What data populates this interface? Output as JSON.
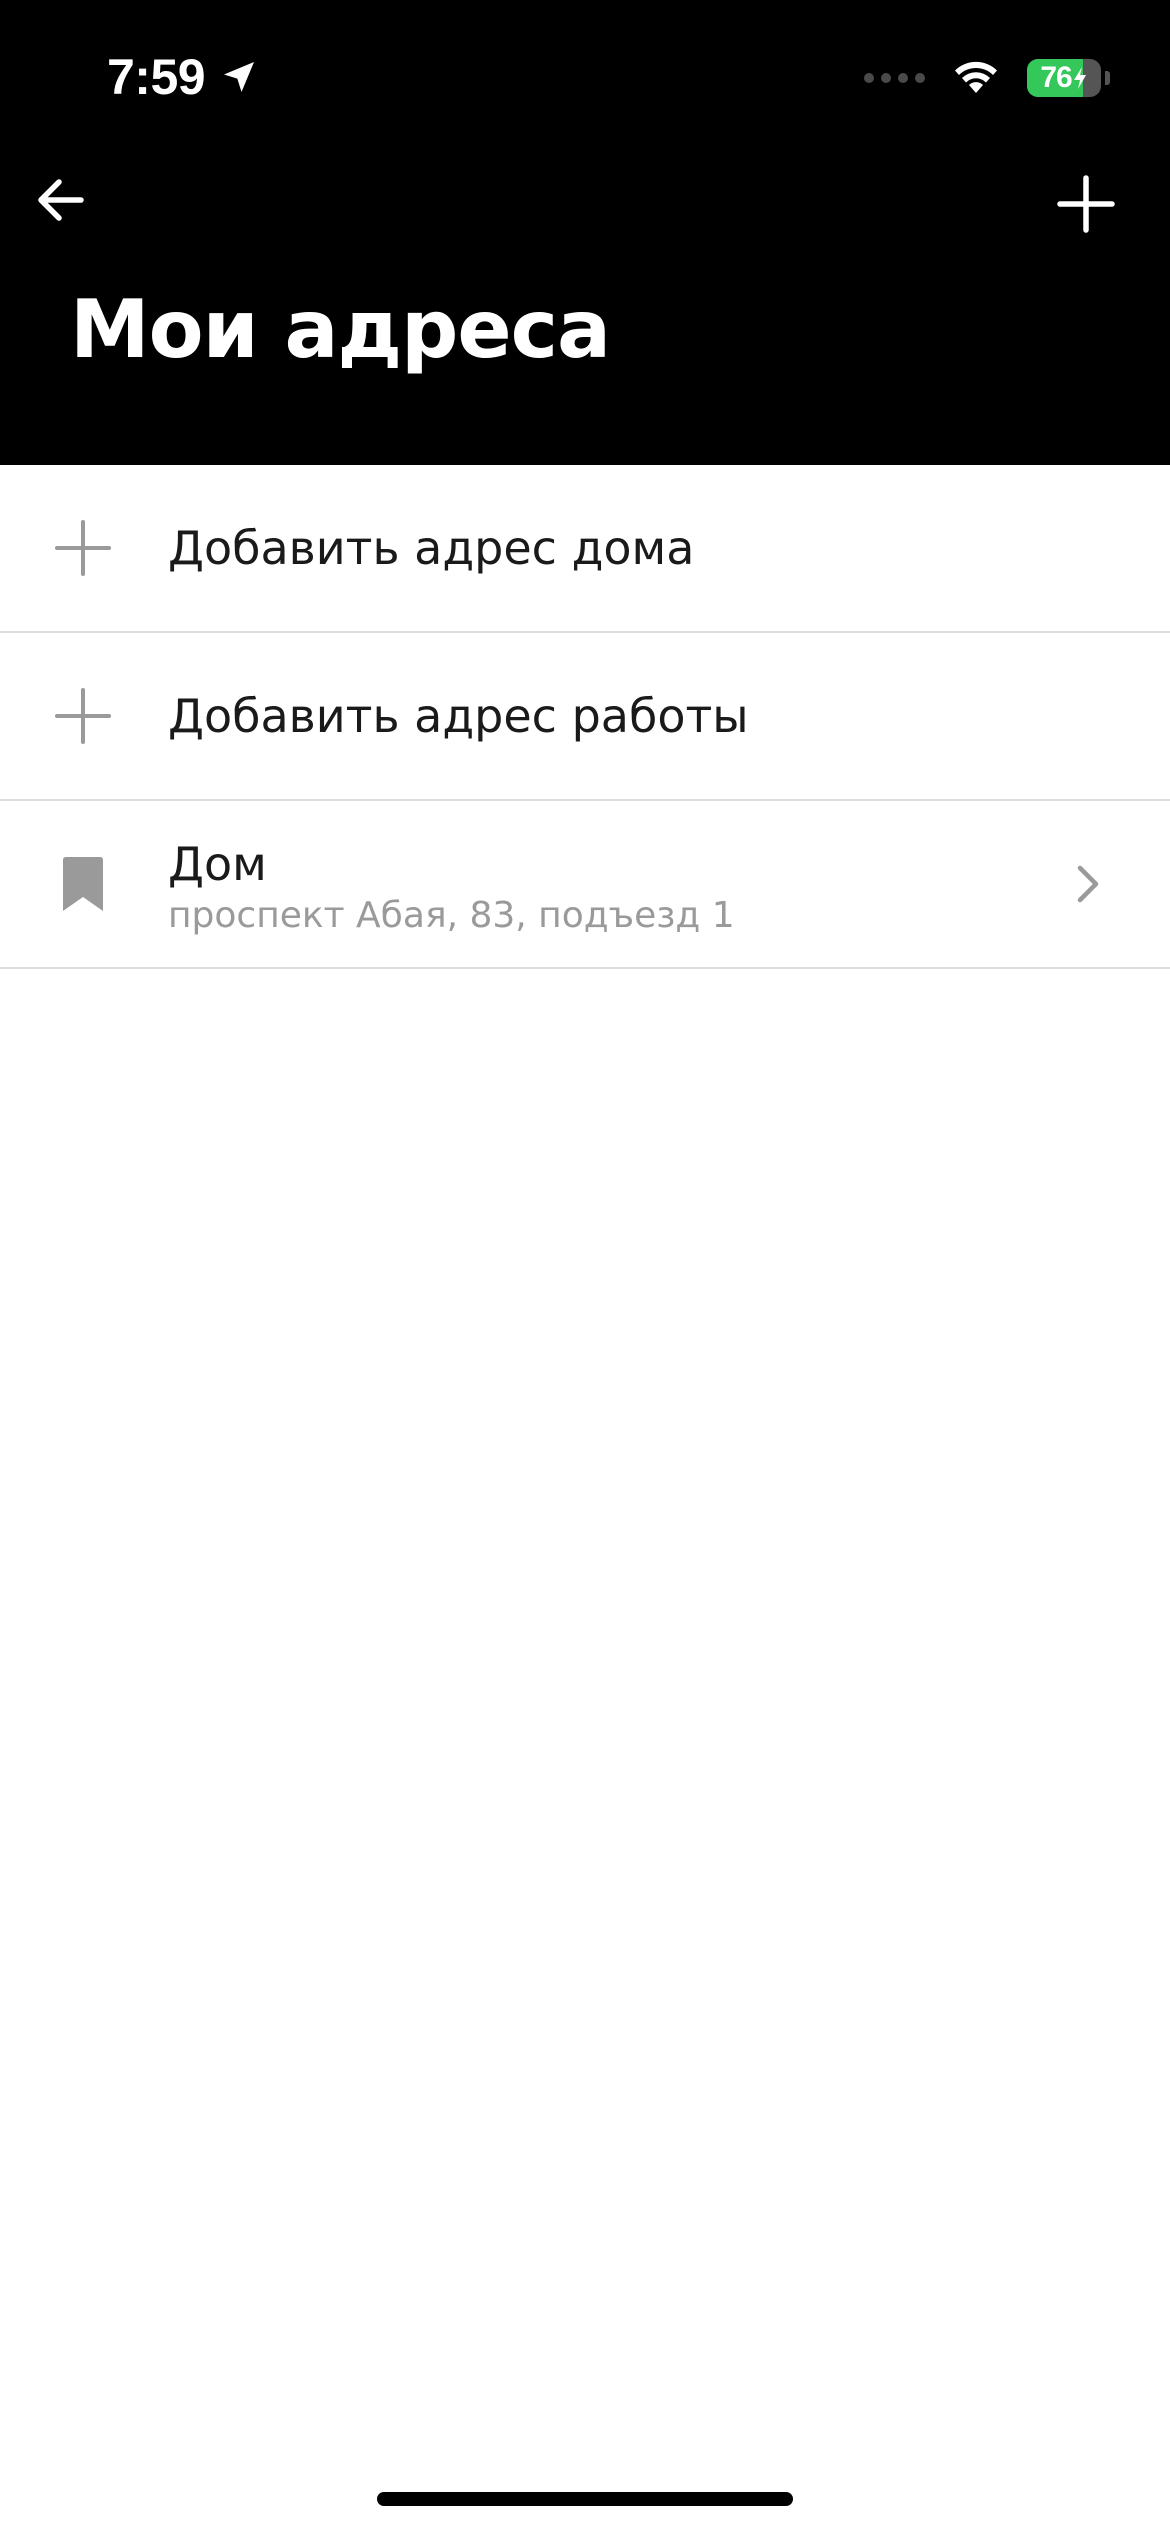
{
  "status_bar": {
    "time": "7:59",
    "battery_percent": "76",
    "battery_level": 0.76
  },
  "header": {
    "title": "Мои адреса"
  },
  "list": {
    "add_home_label": "Добавить адрес дома",
    "add_work_label": "Добавить адрес работы",
    "saved": [
      {
        "title": "Дом",
        "address": "проспект Абая, 83, подъезд 1"
      }
    ]
  },
  "colors": {
    "header_bg": "#000000",
    "battery_green": "#34c759",
    "icon_gray": "#9a9a9a",
    "divider": "#dedede"
  }
}
